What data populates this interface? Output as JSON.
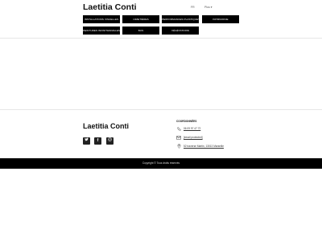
{
  "header": {
    "site_title": "Laetitia Conti",
    "language": "FR",
    "more_label": "Plus"
  },
  "nav": {
    "items": [
      "Installations visuelles",
      "Cimetières",
      "Performances plastiques",
      "Patrimoine",
      "Peintures infinitesimales",
      "Bus",
      "Végétations"
    ]
  },
  "footer": {
    "name": "Laetitia Conti",
    "coordinates_title": "Coordonnées",
    "phone": "06 09 97 47 72",
    "email": "[email protected]",
    "address": "52 traverse Martin, 13013 Marseille",
    "copyright": "Copyright © Tous droits réservés",
    "social": [
      {
        "name": "twitter-icon",
        "glyph": "🐦"
      },
      {
        "name": "facebook-icon",
        "glyph": "f"
      },
      {
        "name": "instagram-icon",
        "glyph": "◎"
      }
    ]
  }
}
